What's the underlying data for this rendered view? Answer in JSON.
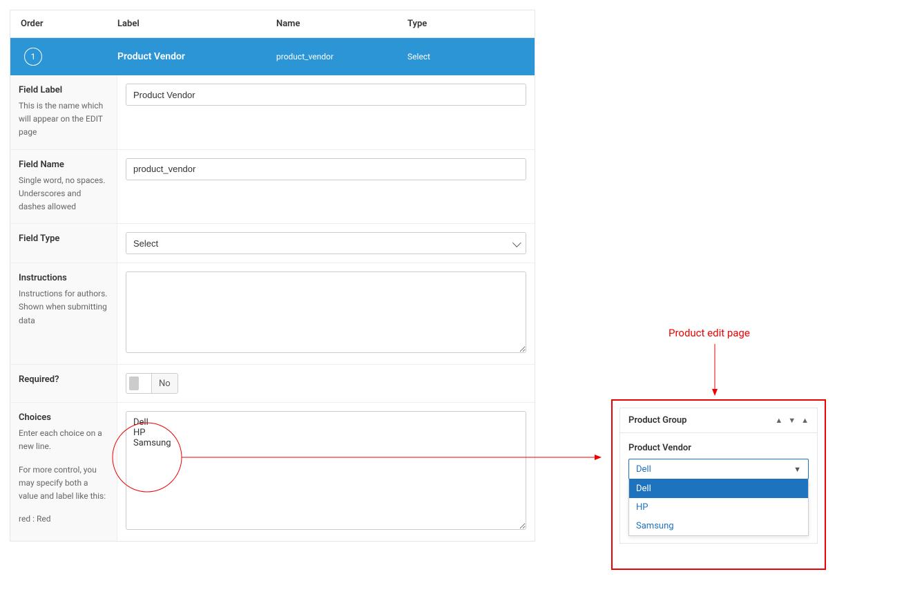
{
  "headers": {
    "order": "Order",
    "label": "Label",
    "name": "Name",
    "type": "Type"
  },
  "summary": {
    "order": "1",
    "label": "Product Vendor",
    "name": "product_vendor",
    "type": "Select"
  },
  "fields": {
    "field_label": {
      "title": "Field Label",
      "desc": "This is the name which will appear on the EDIT page",
      "value": "Product Vendor"
    },
    "field_name": {
      "title": "Field Name",
      "desc": "Single word, no spaces. Underscores and dashes allowed",
      "value": "product_vendor"
    },
    "field_type": {
      "title": "Field Type",
      "value": "Select"
    },
    "instructions": {
      "title": "Instructions",
      "desc": "Instructions for authors. Shown when submitting data",
      "value": ""
    },
    "required": {
      "title": "Required?",
      "value": "No"
    },
    "choices": {
      "title": "Choices",
      "desc1": "Enter each choice on a new line.",
      "desc2": "For more control, you may specify both a value and label like this:",
      "desc3": "red : Red",
      "value": "Dell\nHP\nSamsung"
    }
  },
  "annotation": {
    "label": "Product edit page"
  },
  "preview": {
    "widget_title": "Product Group",
    "field_label": "Product Vendor",
    "selected": "Dell",
    "options": [
      "Dell",
      "HP",
      "Samsung"
    ]
  }
}
